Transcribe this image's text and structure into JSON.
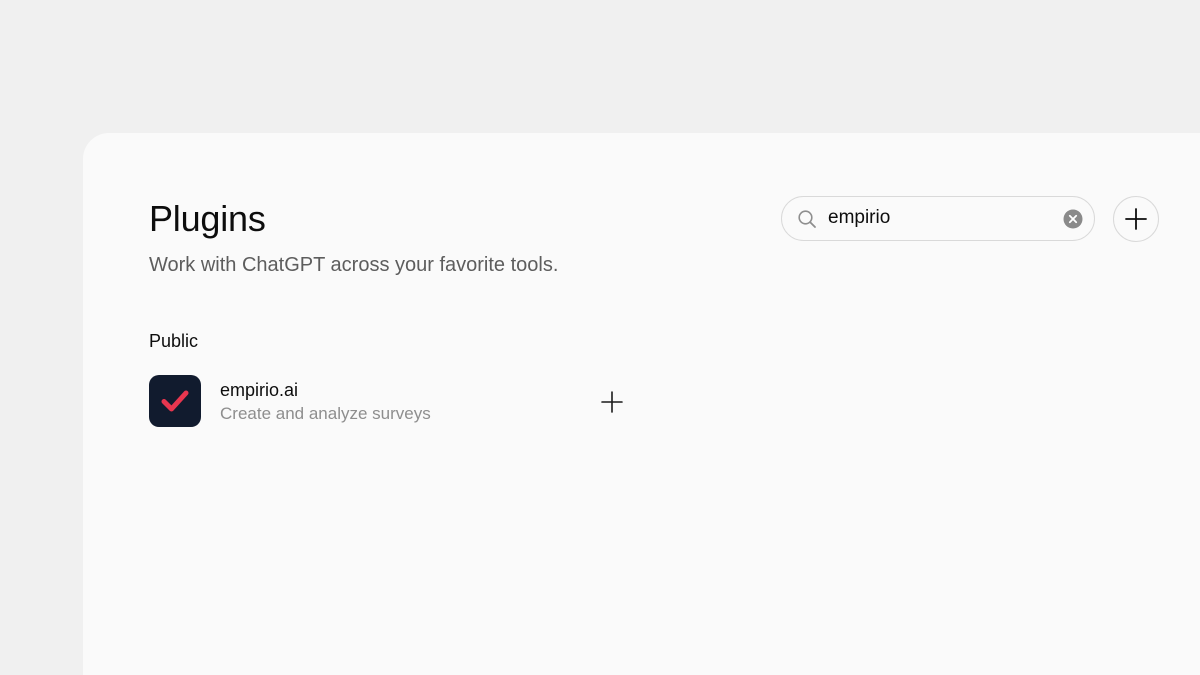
{
  "header": {
    "title": "Plugins",
    "subtitle": "Work with ChatGPT across your favorite tools."
  },
  "search": {
    "value": "empirio",
    "icon": "search-icon",
    "clear_icon": "clear-icon"
  },
  "add_plugin_button": {
    "icon": "plus-icon"
  },
  "sections": [
    {
      "label": "Public",
      "plugins": [
        {
          "name": "empirio.ai",
          "description": "Create and analyze surveys",
          "logo_icon": "checkmark-icon",
          "logo_bg": "#111b2e",
          "logo_accent": "#e8364f",
          "action_icon": "plus-icon"
        }
      ]
    }
  ],
  "colors": {
    "page_bg": "#f0f0f0",
    "panel_bg": "#fafafa",
    "text_primary": "#0d0d0d",
    "text_secondary": "#5d5d5d",
    "text_muted": "#8e8e8e",
    "border": "#d9d9d9"
  }
}
